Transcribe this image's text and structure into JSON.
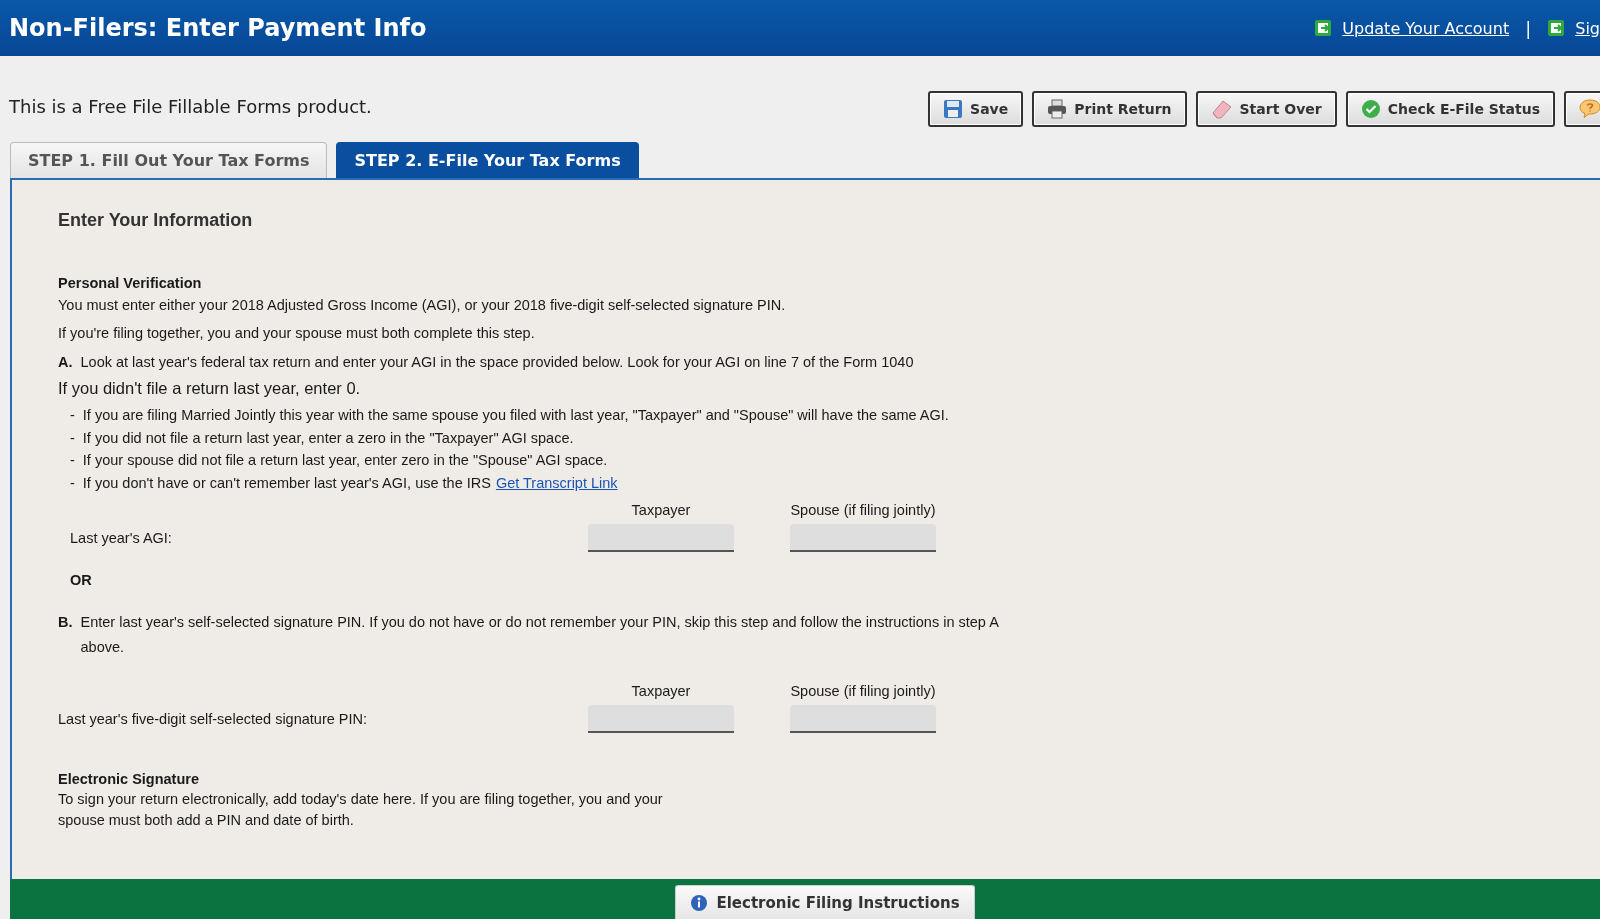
{
  "header": {
    "title": "Non-Filers: Enter Payment Info",
    "links": [
      {
        "label": "Update Your Account"
      },
      {
        "label": "Sig"
      }
    ],
    "separator": "|"
  },
  "product_note": "This is a Free File Fillable Forms product.",
  "toolbar": [
    {
      "kind": "save",
      "label": "Save"
    },
    {
      "kind": "print",
      "label": "Print Return"
    },
    {
      "kind": "eraser",
      "label": "Start Over"
    },
    {
      "kind": "check",
      "label": "Check E-File Status"
    },
    {
      "kind": "help"
    }
  ],
  "tabs": [
    {
      "label": "STEP 1. Fill Out Your Tax Forms",
      "selected": false
    },
    {
      "label": "STEP 2. E-File Your Tax Forms",
      "selected": true
    }
  ],
  "form": {
    "title": "Enter Your Information",
    "verification": {
      "heading": "Personal Verification",
      "lines": [
        "You must enter either your 2018 Adjusted Gross Income (AGI), or your 2018 five-digit self-selected signature PIN.",
        "If you're filing together, you and your spouse must both complete this step."
      ]
    },
    "step_a": {
      "label": "A.",
      "text": "Look at last year's federal tax return and enter your AGI in the space provided below. Look for your AGI on line 7 of the Form 1040",
      "note": "If you didn't file a return last year, enter 0.",
      "bullets": [
        {
          "marker": "-",
          "text": "If you are filing Married Jointly this year with the same spouse you filed with last year, \"Taxpayer\" and \"Spouse\" will have the same AGI."
        },
        {
          "marker": "-",
          "text": "If you did not file a return last year, enter a zero in the \"Taxpayer\" AGI space."
        },
        {
          "marker": "-",
          "text": "If your spouse did not file a return last year, enter zero in the \"Spouse\" AGI space."
        },
        {
          "marker": "-",
          "text": "If you don't have or can't remember last year's AGI, use the IRS",
          "link": "Get Transcript Link"
        }
      ],
      "columns": [
        "Taxpayer",
        "Spouse (if filing jointly)"
      ],
      "row_label": "Last year's AGI:"
    },
    "or": "OR",
    "step_b": {
      "label": "B.",
      "text": "Enter last year's self-selected signature PIN. If you do not have or do not remember your PIN, skip this step and follow the instructions in step A above.",
      "columns": [
        "Taxpayer",
        "Spouse (if filing jointly)"
      ],
      "row_label": "Last year's five-digit self-selected signature PIN:"
    },
    "signature": {
      "heading": "Electronic Signature",
      "text": "To sign your return electronically, add today's date here. If you are filing together, you and your spouse must both add a PIN and date of birth."
    }
  },
  "footer": {
    "button": "Electronic Filing Instructions"
  }
}
